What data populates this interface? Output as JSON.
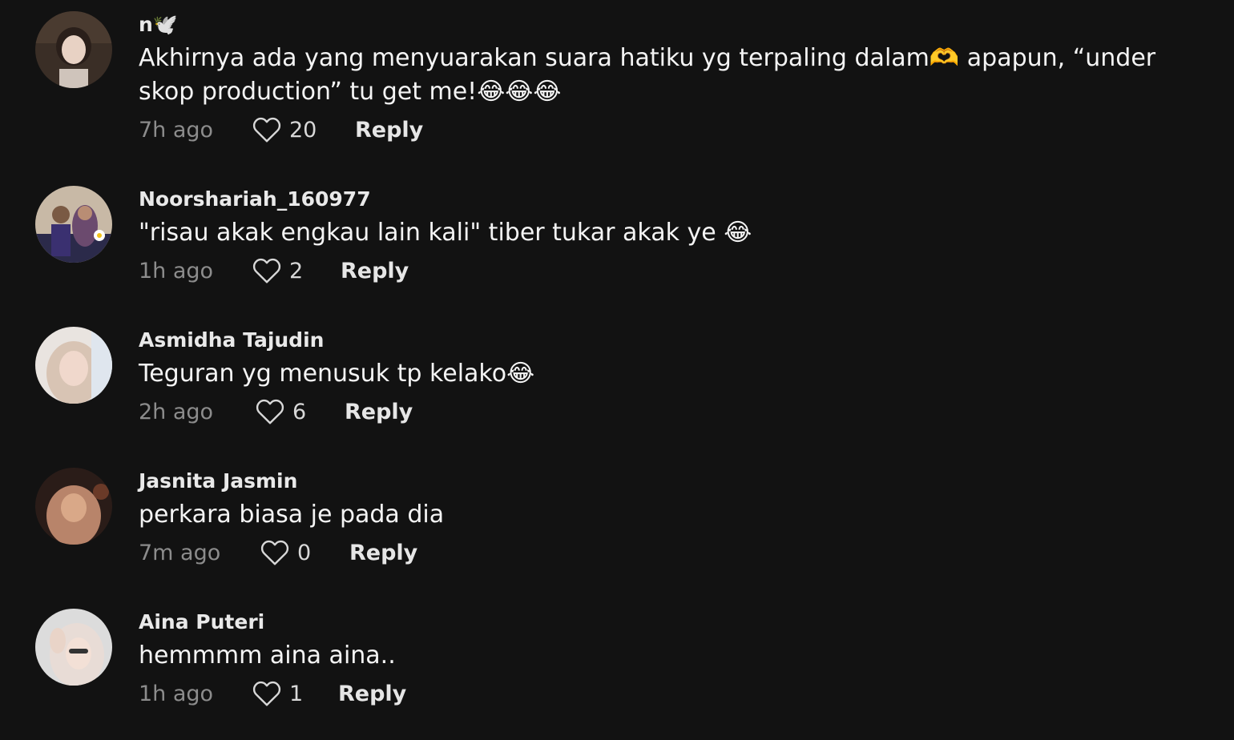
{
  "comments": [
    {
      "username": "n🕊️",
      "text": "Akhirnya ada yang menyuarakan suara hatiku yg terpaling dalam🫶 apapun, “under skop production” tu get me!😂😂😂",
      "time": "7h ago",
      "likes": "20",
      "reply": "Reply"
    },
    {
      "username": "Noorshariah_160977",
      "text": "\"risau akak engkau lain kali\" tiber tukar akak ye 😂",
      "time": "1h ago",
      "likes": "2",
      "reply": "Reply"
    },
    {
      "username": "Asmidha Tajudin",
      "text": "Teguran yg menusuk tp kelako😂",
      "time": "2h ago",
      "likes": "6",
      "reply": "Reply"
    },
    {
      "username": "Jasnita Jasmin",
      "text": "perkara biasa je pada dia",
      "time": "7m ago",
      "likes": "0",
      "reply": "Reply"
    },
    {
      "username": "Aina Puteri",
      "text": "hemmmm aina aina..",
      "time": "1h ago",
      "likes": "1",
      "reply": "Reply"
    }
  ],
  "icons": {
    "like": "heart-outline-icon"
  },
  "colors": {
    "background": "#121212",
    "username": "#e9e9e9",
    "text": "#f4f4f4",
    "time": "#8c8c8c"
  }
}
